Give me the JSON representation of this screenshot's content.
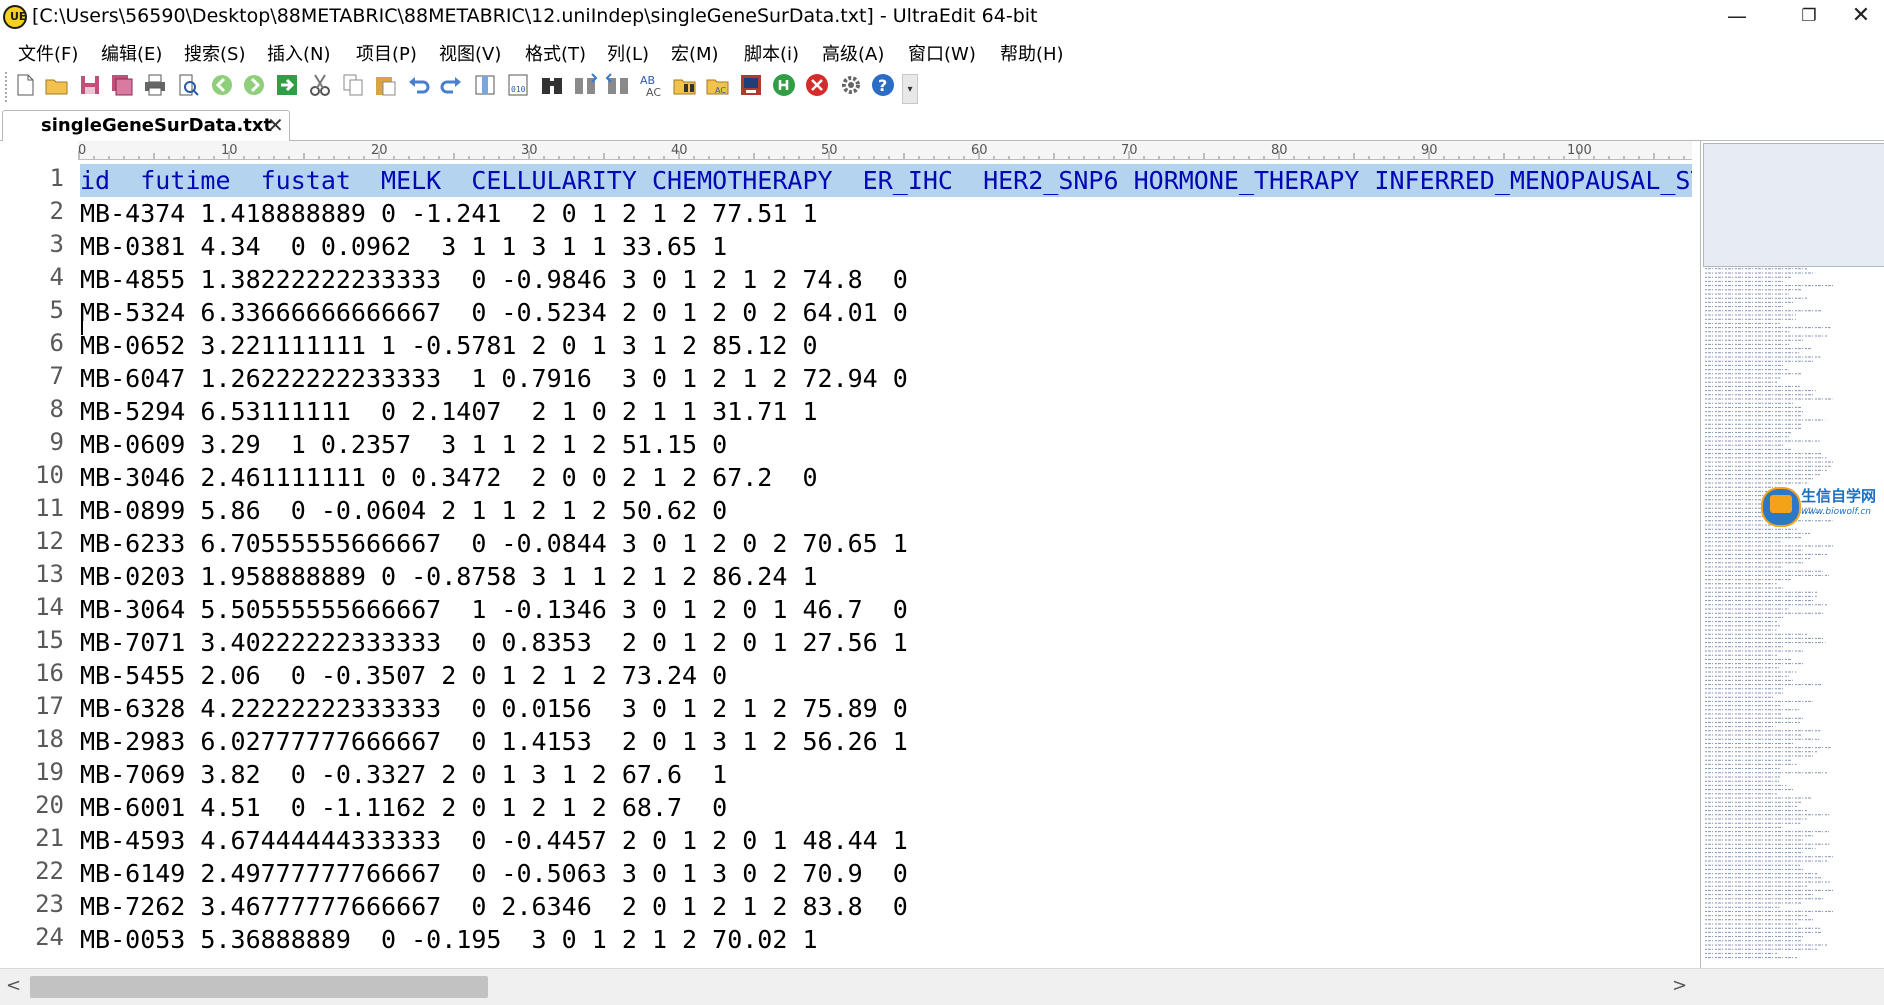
{
  "window": {
    "title": "[C:\\Users\\56590\\Desktop\\88METABRIC\\88METABRIC\\12.uniIndep\\singleGeneSurData.txt] - UltraEdit 64-bit",
    "app_icon_text": "UE",
    "minimize": "—",
    "maximize": "❐",
    "close": "✕"
  },
  "menu": [
    "文件(F)",
    "编辑(E)",
    "搜索(S)",
    "插入(N)",
    "项目(P)",
    "视图(V)",
    "格式(T)",
    "列(L)",
    "宏(M)",
    "脚本(i)",
    "高级(A)",
    "窗口(W)",
    "帮助(H)"
  ],
  "toolbar": {
    "icons": [
      "new-file-icon",
      "open-folder-icon",
      "save-icon",
      "save-all-icon",
      "print-icon",
      "print-preview-icon",
      "back-icon",
      "forward-icon",
      "goto-icon",
      "cut-icon",
      "copy-icon",
      "paste-icon",
      "undo-icon",
      "redo-icon",
      "column-mode-icon",
      "hex-mode-icon",
      "find-icon",
      "find-next-icon",
      "find-prev-icon",
      "replace-icon",
      "find-in-files-icon",
      "replace-in-files-icon",
      "ftp-icon",
      "macro-record-icon",
      "macro-stop-icon",
      "settings-icon",
      "help-icon"
    ],
    "overflow": "▾"
  },
  "tabs": [
    {
      "label": "singleGeneSurData.txt",
      "close": "✕"
    }
  ],
  "ruler": {
    "labels": [
      "0",
      "10",
      "20",
      "30",
      "40",
      "50",
      "60",
      "70",
      "80",
      "90",
      "100"
    ]
  },
  "lines": [
    "id  futime  fustat  MELK  CELLULARITY CHEMOTHERAPY  ER_IHC  HER2_SNP6 HORMONE_THERAPY INFERRED_MENOPAUSAL_STATE",
    "MB-4374 1.418888889 0 -1.241  2 0 1 2 1 2 77.51 1",
    "MB-0381 4.34  0 0.0962  3 1 1 3 1 1 33.65 1",
    "MB-4855 1.38222222233333  0 -0.9846 3 0 1 2 1 2 74.8  0",
    "MB-5324 6.33666666666667  0 -0.5234 2 0 1 2 0 2 64.01 0",
    "MB-0652 3.221111111 1 -0.5781 2 0 1 3 1 2 85.12 0",
    "MB-6047 1.26222222233333  1 0.7916  3 0 1 2 1 2 72.94 0",
    "MB-5294 6.53111111  0 2.1407  2 1 0 2 1 1 31.71 1",
    "MB-0609 3.29  1 0.2357  3 1 1 2 1 2 51.15 0",
    "MB-3046 2.461111111 0 0.3472  2 0 0 2 1 2 67.2  0",
    "MB-0899 5.86  0 -0.0604 2 1 1 2 1 2 50.62 0",
    "MB-6233 6.70555555666667  0 -0.0844 3 0 1 2 0 2 70.65 1",
    "MB-0203 1.958888889 0 -0.8758 3 1 1 2 1 2 86.24 1",
    "MB-3064 5.50555555666667  1 -0.1346 3 0 1 2 0 1 46.7  0",
    "MB-7071 3.40222222333333  0 0.8353  2 0 1 2 0 1 27.56 1",
    "MB-5455 2.06  0 -0.3507 2 0 1 2 1 2 73.24 0",
    "MB-6328 4.22222222333333  0 0.0156  3 0 1 2 1 2 75.89 0",
    "MB-2983 6.02777777666667  0 1.4153  2 0 1 3 1 2 56.26 1",
    "MB-7069 3.82  0 -0.3327 2 0 1 3 1 2 67.6  1",
    "MB-6001 4.51  0 -1.1162 2 0 1 2 1 2 68.7  0",
    "MB-4593 4.67444444333333  0 -0.4457 2 0 1 2 0 1 48.44 1",
    "MB-6149 2.49777777766667  0 -0.5063 3 0 1 3 0 2 70.9  0",
    "MB-7262 3.46777777666667  0 2.6346  2 0 1 2 1 2 83.8  0",
    "MB-0053 5.36888889  0 -0.195  3 0 1 2 1 2 70.02 1"
  ],
  "logo": {
    "title": "生信自学网",
    "url": "www.biowolf.cn"
  },
  "scrollbar": {
    "left": "<",
    "right": ">"
  },
  "colors": {
    "selection": "#b4d3ef",
    "selection_text": "#0008b6",
    "line_numbers": "#595959"
  }
}
